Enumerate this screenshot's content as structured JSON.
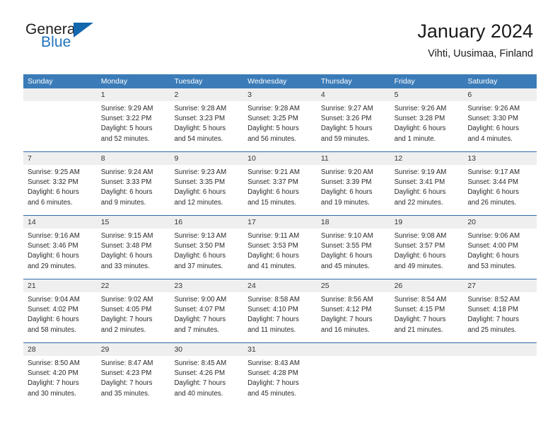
{
  "brand": {
    "name_part1": "General",
    "name_part2": "Blue",
    "flag_icon": "triangle-flag-icon"
  },
  "header": {
    "title": "January 2024",
    "location": "Vihti, Uusimaa, Finland"
  },
  "colors": {
    "header_blue": "#3b7cb8",
    "row_divider_blue": "#2f6ca6",
    "day_band_gray": "#efefef",
    "brand_blue": "#1f73bd",
    "text": "#2a2a2a"
  },
  "weekday_headers": [
    "Sunday",
    "Monday",
    "Tuesday",
    "Wednesday",
    "Thursday",
    "Friday",
    "Saturday"
  ],
  "weeks": [
    [
      {
        "day": "",
        "lines": []
      },
      {
        "day": "1",
        "lines": [
          "Sunrise: 9:29 AM",
          "Sunset: 3:22 PM",
          "Daylight: 5 hours",
          "and 52 minutes."
        ]
      },
      {
        "day": "2",
        "lines": [
          "Sunrise: 9:28 AM",
          "Sunset: 3:23 PM",
          "Daylight: 5 hours",
          "and 54 minutes."
        ]
      },
      {
        "day": "3",
        "lines": [
          "Sunrise: 9:28 AM",
          "Sunset: 3:25 PM",
          "Daylight: 5 hours",
          "and 56 minutes."
        ]
      },
      {
        "day": "4",
        "lines": [
          "Sunrise: 9:27 AM",
          "Sunset: 3:26 PM",
          "Daylight: 5 hours",
          "and 59 minutes."
        ]
      },
      {
        "day": "5",
        "lines": [
          "Sunrise: 9:26 AM",
          "Sunset: 3:28 PM",
          "Daylight: 6 hours",
          "and 1 minute."
        ]
      },
      {
        "day": "6",
        "lines": [
          "Sunrise: 9:26 AM",
          "Sunset: 3:30 PM",
          "Daylight: 6 hours",
          "and 4 minutes."
        ]
      }
    ],
    [
      {
        "day": "7",
        "lines": [
          "Sunrise: 9:25 AM",
          "Sunset: 3:32 PM",
          "Daylight: 6 hours",
          "and 6 minutes."
        ]
      },
      {
        "day": "8",
        "lines": [
          "Sunrise: 9:24 AM",
          "Sunset: 3:33 PM",
          "Daylight: 6 hours",
          "and 9 minutes."
        ]
      },
      {
        "day": "9",
        "lines": [
          "Sunrise: 9:23 AM",
          "Sunset: 3:35 PM",
          "Daylight: 6 hours",
          "and 12 minutes."
        ]
      },
      {
        "day": "10",
        "lines": [
          "Sunrise: 9:21 AM",
          "Sunset: 3:37 PM",
          "Daylight: 6 hours",
          "and 15 minutes."
        ]
      },
      {
        "day": "11",
        "lines": [
          "Sunrise: 9:20 AM",
          "Sunset: 3:39 PM",
          "Daylight: 6 hours",
          "and 19 minutes."
        ]
      },
      {
        "day": "12",
        "lines": [
          "Sunrise: 9:19 AM",
          "Sunset: 3:41 PM",
          "Daylight: 6 hours",
          "and 22 minutes."
        ]
      },
      {
        "day": "13",
        "lines": [
          "Sunrise: 9:17 AM",
          "Sunset: 3:44 PM",
          "Daylight: 6 hours",
          "and 26 minutes."
        ]
      }
    ],
    [
      {
        "day": "14",
        "lines": [
          "Sunrise: 9:16 AM",
          "Sunset: 3:46 PM",
          "Daylight: 6 hours",
          "and 29 minutes."
        ]
      },
      {
        "day": "15",
        "lines": [
          "Sunrise: 9:15 AM",
          "Sunset: 3:48 PM",
          "Daylight: 6 hours",
          "and 33 minutes."
        ]
      },
      {
        "day": "16",
        "lines": [
          "Sunrise: 9:13 AM",
          "Sunset: 3:50 PM",
          "Daylight: 6 hours",
          "and 37 minutes."
        ]
      },
      {
        "day": "17",
        "lines": [
          "Sunrise: 9:11 AM",
          "Sunset: 3:53 PM",
          "Daylight: 6 hours",
          "and 41 minutes."
        ]
      },
      {
        "day": "18",
        "lines": [
          "Sunrise: 9:10 AM",
          "Sunset: 3:55 PM",
          "Daylight: 6 hours",
          "and 45 minutes."
        ]
      },
      {
        "day": "19",
        "lines": [
          "Sunrise: 9:08 AM",
          "Sunset: 3:57 PM",
          "Daylight: 6 hours",
          "and 49 minutes."
        ]
      },
      {
        "day": "20",
        "lines": [
          "Sunrise: 9:06 AM",
          "Sunset: 4:00 PM",
          "Daylight: 6 hours",
          "and 53 minutes."
        ]
      }
    ],
    [
      {
        "day": "21",
        "lines": [
          "Sunrise: 9:04 AM",
          "Sunset: 4:02 PM",
          "Daylight: 6 hours",
          "and 58 minutes."
        ]
      },
      {
        "day": "22",
        "lines": [
          "Sunrise: 9:02 AM",
          "Sunset: 4:05 PM",
          "Daylight: 7 hours",
          "and 2 minutes."
        ]
      },
      {
        "day": "23",
        "lines": [
          "Sunrise: 9:00 AM",
          "Sunset: 4:07 PM",
          "Daylight: 7 hours",
          "and 7 minutes."
        ]
      },
      {
        "day": "24",
        "lines": [
          "Sunrise: 8:58 AM",
          "Sunset: 4:10 PM",
          "Daylight: 7 hours",
          "and 11 minutes."
        ]
      },
      {
        "day": "25",
        "lines": [
          "Sunrise: 8:56 AM",
          "Sunset: 4:12 PM",
          "Daylight: 7 hours",
          "and 16 minutes."
        ]
      },
      {
        "day": "26",
        "lines": [
          "Sunrise: 8:54 AM",
          "Sunset: 4:15 PM",
          "Daylight: 7 hours",
          "and 21 minutes."
        ]
      },
      {
        "day": "27",
        "lines": [
          "Sunrise: 8:52 AM",
          "Sunset: 4:18 PM",
          "Daylight: 7 hours",
          "and 25 minutes."
        ]
      }
    ],
    [
      {
        "day": "28",
        "lines": [
          "Sunrise: 8:50 AM",
          "Sunset: 4:20 PM",
          "Daylight: 7 hours",
          "and 30 minutes."
        ]
      },
      {
        "day": "29",
        "lines": [
          "Sunrise: 8:47 AM",
          "Sunset: 4:23 PM",
          "Daylight: 7 hours",
          "and 35 minutes."
        ]
      },
      {
        "day": "30",
        "lines": [
          "Sunrise: 8:45 AM",
          "Sunset: 4:26 PM",
          "Daylight: 7 hours",
          "and 40 minutes."
        ]
      },
      {
        "day": "31",
        "lines": [
          "Sunrise: 8:43 AM",
          "Sunset: 4:28 PM",
          "Daylight: 7 hours",
          "and 45 minutes."
        ]
      },
      {
        "day": "",
        "lines": []
      },
      {
        "day": "",
        "lines": []
      },
      {
        "day": "",
        "lines": []
      }
    ]
  ]
}
